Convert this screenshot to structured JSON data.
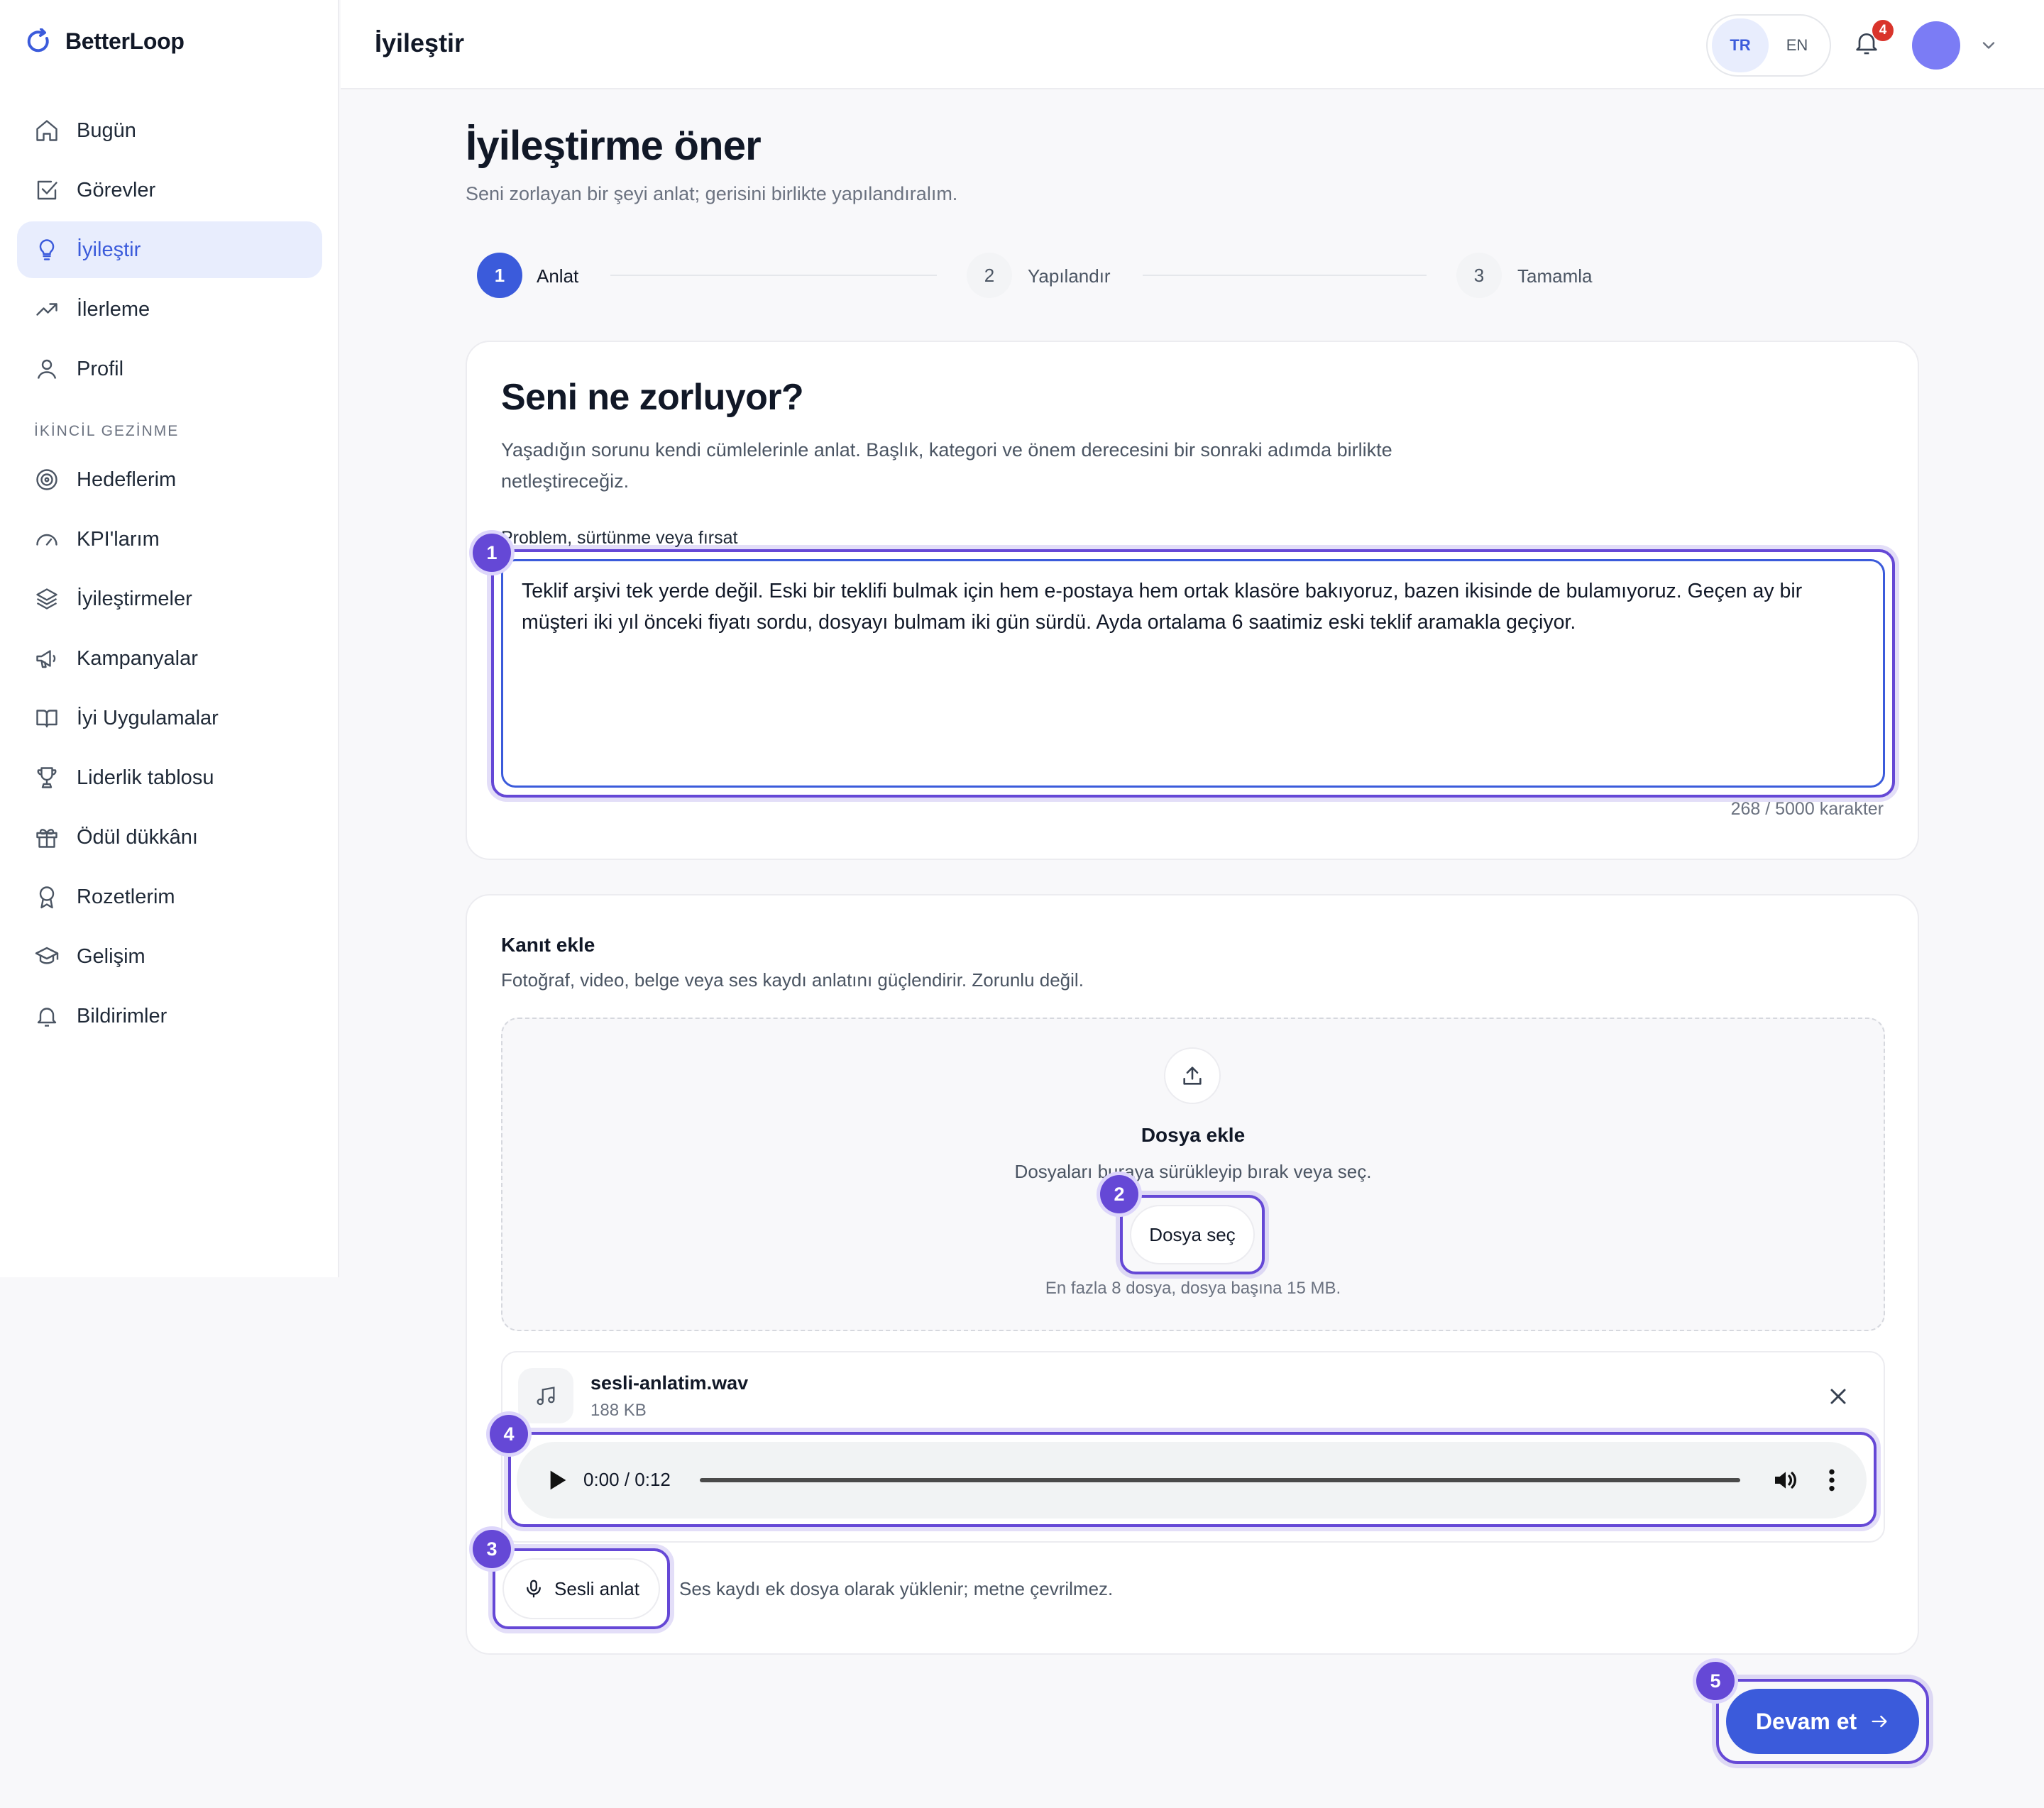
{
  "app": {
    "name": "BetterLoop"
  },
  "sidebar": {
    "items": [
      {
        "label": "Bugün",
        "icon": "home-icon",
        "active": false
      },
      {
        "label": "Görevler",
        "icon": "checkbox-icon",
        "active": false
      },
      {
        "label": "İyileştir",
        "icon": "lightbulb-icon",
        "active": true
      },
      {
        "label": "İlerleme",
        "icon": "trend-up-icon",
        "active": false
      },
      {
        "label": "Profil",
        "icon": "user-icon",
        "active": false
      }
    ],
    "secondary_label": "İKİNCİL GEZİNME",
    "secondary_items": [
      {
        "label": "Hedeflerim",
        "icon": "target-icon"
      },
      {
        "label": "KPI'larım",
        "icon": "gauge-icon"
      },
      {
        "label": "İyileştirmeler",
        "icon": "layers-icon"
      },
      {
        "label": "Kampanyalar",
        "icon": "megaphone-icon"
      },
      {
        "label": "İyi Uygulamalar",
        "icon": "book-icon"
      },
      {
        "label": "Liderlik tablosu",
        "icon": "trophy-icon"
      },
      {
        "label": "Ödül dükkânı",
        "icon": "gift-icon"
      },
      {
        "label": "Rozetlerim",
        "icon": "award-icon"
      },
      {
        "label": "Gelişim",
        "icon": "graduation-cap-icon"
      },
      {
        "label": "Bildirimler",
        "icon": "bell-icon"
      }
    ]
  },
  "header": {
    "title": "İyileştir",
    "languages": [
      "TR",
      "EN"
    ],
    "active_language": "TR",
    "notification_count": "4"
  },
  "page": {
    "title": "İyileştirme öner",
    "subtitle": "Seni zorlayan bir şeyi anlat; gerisini birlikte yapılandıralım."
  },
  "stepper": [
    {
      "number": "1",
      "label": "Anlat",
      "active": true
    },
    {
      "number": "2",
      "label": "Yapılandır",
      "active": false
    },
    {
      "number": "3",
      "label": "Tamamla",
      "active": false
    }
  ],
  "problem": {
    "title": "Seni ne zorluyor?",
    "description": "Yaşadığın sorunu kendi cümlelerinle anlat. Başlık, kategori ve önem derecesini bir sonraki adımda birlikte netleştireceğiz.",
    "field_label": "Problem, sürtünme veya fırsat",
    "value": "Teklif arşivi tek yerde değil. Eski bir teklifi bulmak için hem e-postaya hem ortak klasöre bakıyoruz, bazen ikisinde de bulamıyoruz. Geçen ay bir müşteri iki yıl önceki fiyatı sordu, dosyayı bulmam iki gün sürdü. Ayda ortalama 6 saatimiz eski teklif aramakla geçiyor.",
    "counter": "268 / 5000 karakter"
  },
  "evidence": {
    "title": "Kanıt ekle",
    "description": "Fotoğraf, video, belge veya ses kaydı anlatını güçlendirir. Zorunlu değil.",
    "dropzone_title": "Dosya ekle",
    "dropzone_desc": "Dosyaları buraya sürükleyip bırak veya seç.",
    "choose_button": "Dosya seç",
    "limit_hint": "En fazla 8 dosya, dosya başına 15 MB.",
    "file": {
      "name": "sesli-anlatim.wav",
      "size": "188 KB",
      "audio_time": "0:00 / 0:12"
    },
    "voice_button": "Sesli anlat",
    "voice_note": "Ses kaydı ek dosya olarak yüklenir; metne çevrilmez."
  },
  "annotations": [
    "1",
    "2",
    "3",
    "4",
    "5"
  ],
  "continue_button": "Devam et",
  "colors": {
    "accent": "#3b5bdb",
    "highlight": "#6548d6",
    "active_bg": "#e8edfd",
    "badge": "#d9342b",
    "avatar": "#7b7cf5"
  }
}
